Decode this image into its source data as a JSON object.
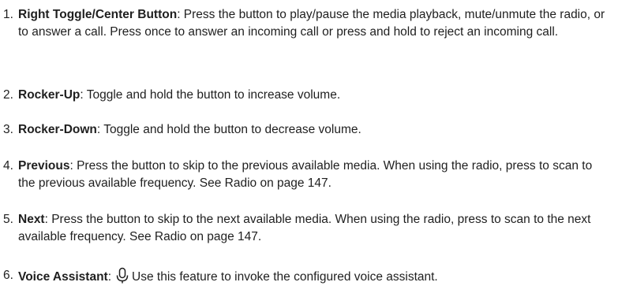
{
  "items": [
    {
      "number": "1.",
      "label": "Right Toggle/Center Button",
      "text": ": Press the button to play/pause the media playback, mute/unmute the radio, or to answer a call. Press once to answer an incoming call or press and hold to reject an incoming call."
    },
    {
      "number": "2.",
      "label": "Rocker-Up",
      "text": ": Toggle and hold the button to increase volume."
    },
    {
      "number": "3.",
      "label": "Rocker-Down",
      "text": ": Toggle and hold the button to decrease volume."
    },
    {
      "number": "4.",
      "label": "Previous",
      "text": ": Press the button to skip to the previous available media. When using the radio, press to scan to the previous available frequency. See Radio on page 147."
    },
    {
      "number": "5.",
      "label": "Next",
      "text": ": Press the button to skip to the next available media. When using the radio, press to scan to the next available frequency. See Radio on page 147."
    },
    {
      "number": "6.",
      "label": "Voice Assistant",
      "text_before_icon": ":",
      "icon": "microphone-icon",
      "text": "Use this feature to invoke the configured voice assistant."
    }
  ]
}
